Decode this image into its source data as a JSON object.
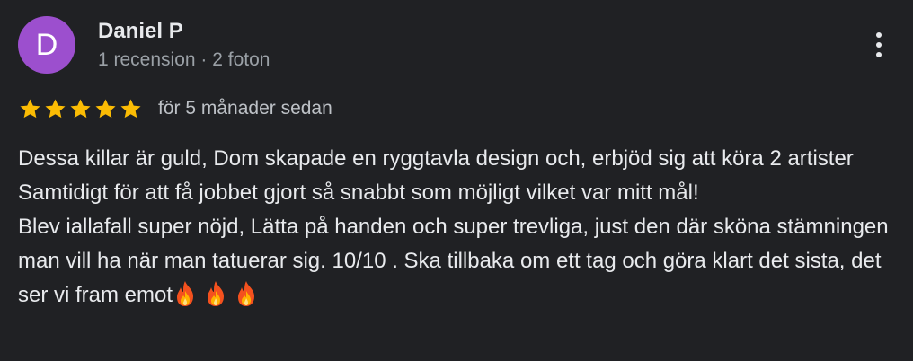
{
  "author": {
    "initial": "D",
    "name": "Daniel P",
    "meta": "1 recension · 2 foton",
    "avatar_color": "#9c4fce"
  },
  "menu": {
    "icon": "more-vert-icon"
  },
  "rating": {
    "stars": 5,
    "max": 5,
    "star_color": "#fbbc04",
    "icon": "star-icon",
    "date": "för 5 månader sedan"
  },
  "review": {
    "paragraph1": "Dessa killar är guld, Dom skapade en ryggtavla design och, erbjöd sig att köra 2 artister Samtidigt för att få jobbet gjort så snabbt som möjligt vilket var mitt mål!",
    "paragraph2": "Blev iallafall super nöjd, Lätta på handen och super trevliga, just den där sköna stämningen man vill ha när man tatuerar sig. 10/10 . Ska tillbaka om ett tag och göra klart det sista, det ser vi fram emot",
    "emoji_icon": "fire-emoji-icon",
    "emoji_count": 3
  }
}
